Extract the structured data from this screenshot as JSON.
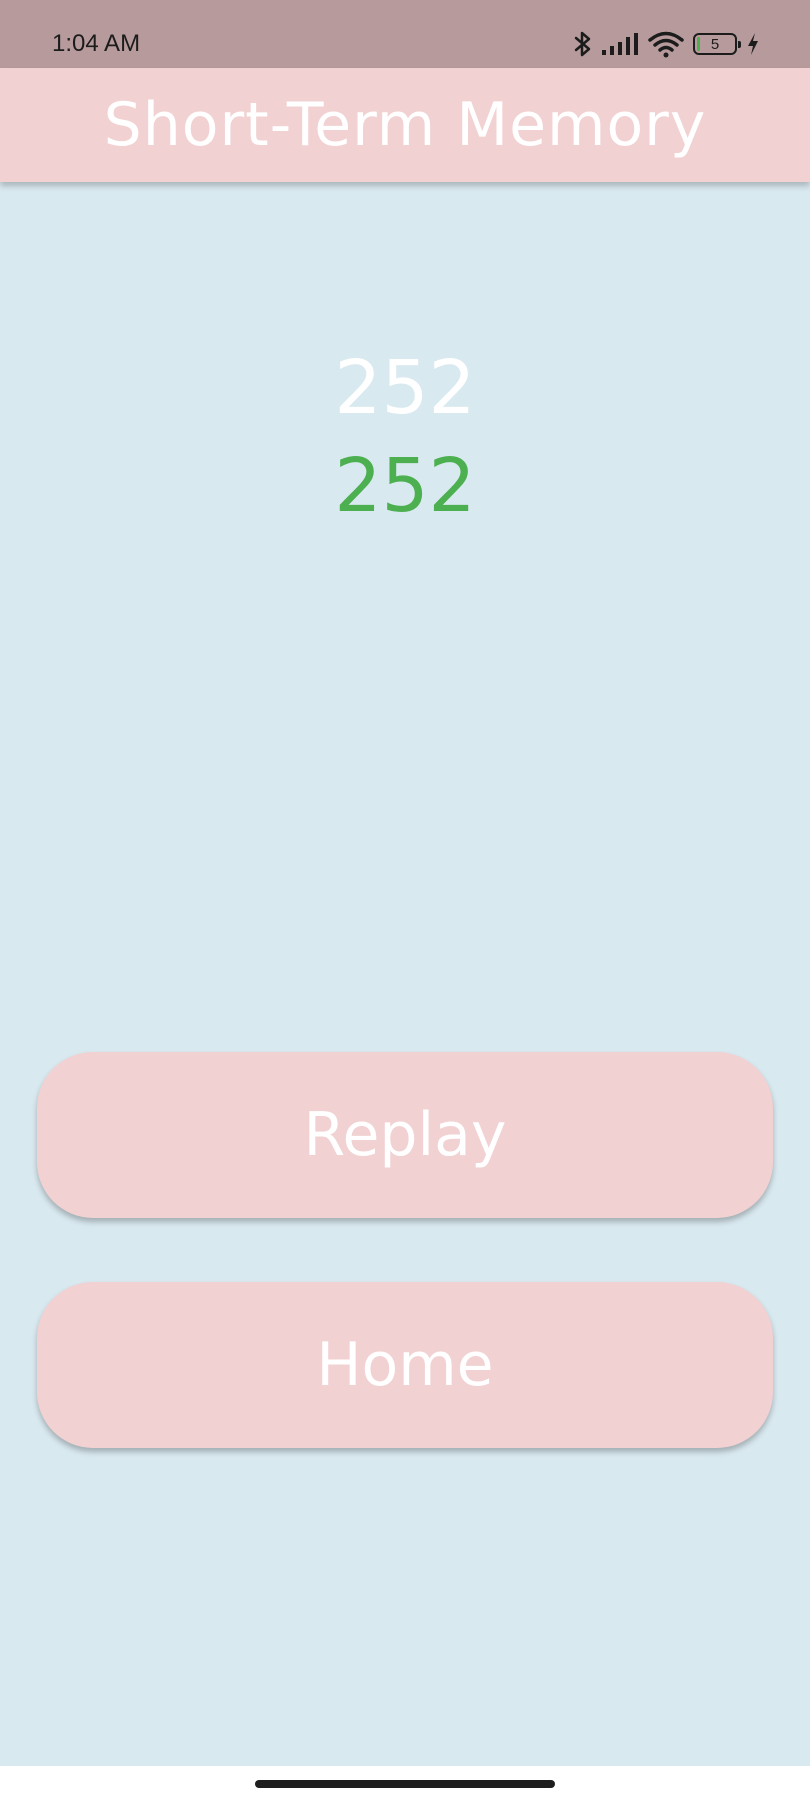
{
  "status_bar": {
    "time": "1:04 AM",
    "battery_level": "5",
    "battery_fraction": 0.05,
    "icons": [
      "bluetooth-icon",
      "signal-icon",
      "wifi-icon",
      "battery-icon",
      "charging-icon"
    ]
  },
  "app_bar": {
    "title": "Short-Term Memory"
  },
  "game": {
    "target_number": "252",
    "entered_number": "252",
    "match_color": "#4caf50"
  },
  "buttons": {
    "replay_label": "Replay",
    "home_label": "Home"
  },
  "colors": {
    "status_bar": "#b79b9c",
    "app_bar": "#f1d1d1",
    "background": "#d9e9f0",
    "button": "#f1d1d1",
    "text": "#ffffff",
    "correct": "#4caf50"
  }
}
